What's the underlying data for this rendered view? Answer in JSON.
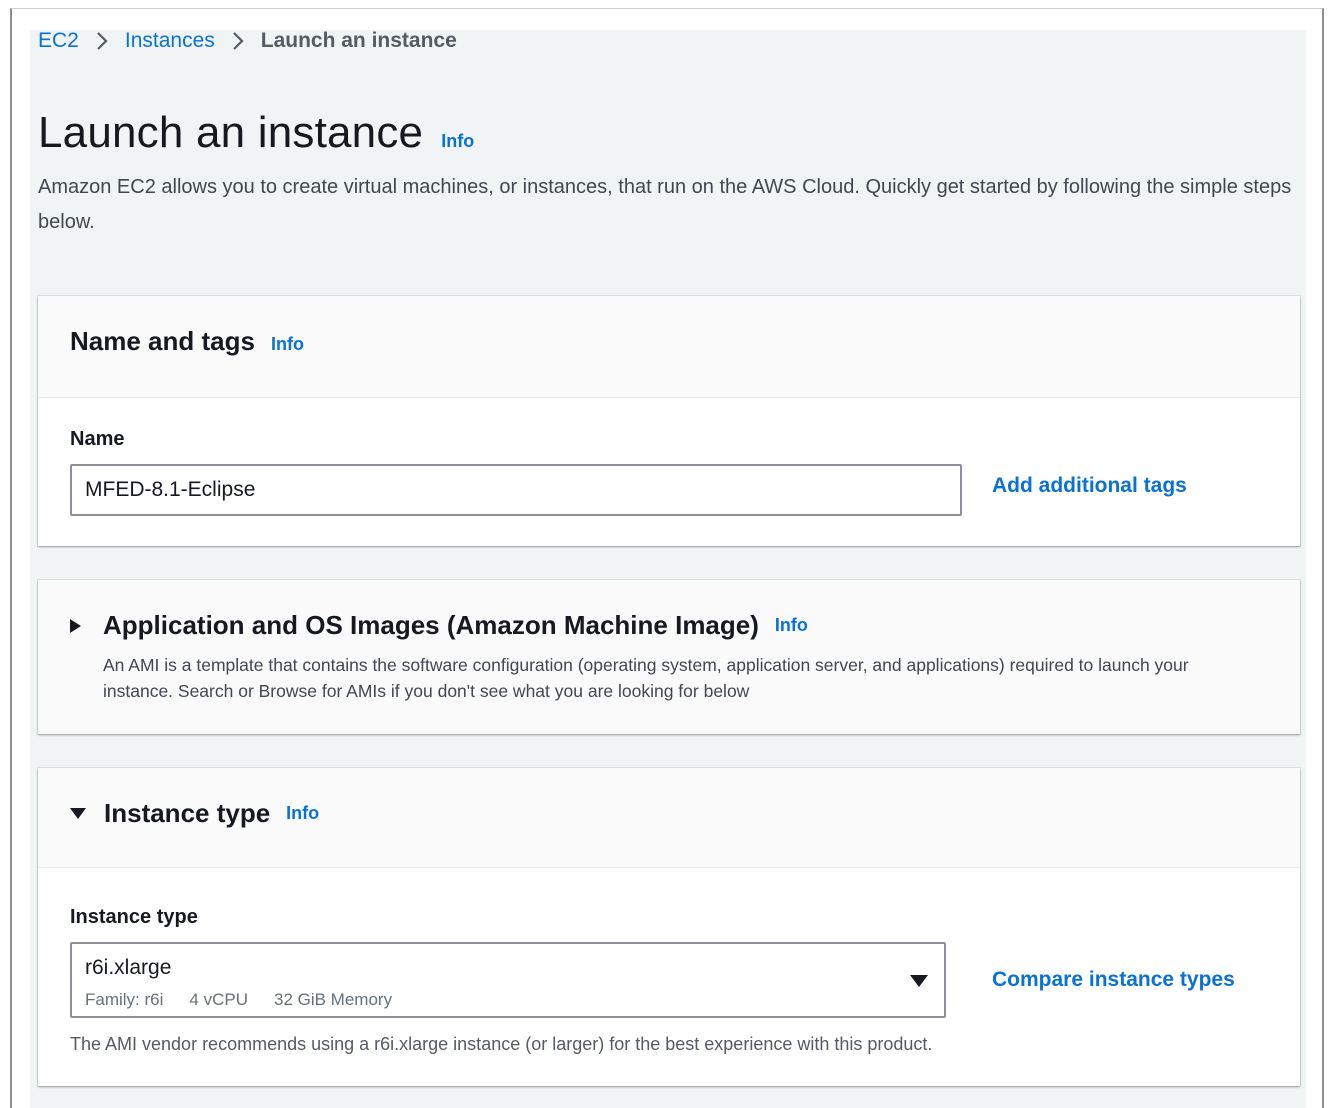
{
  "breadcrumb": {
    "items": [
      "EC2",
      "Instances"
    ],
    "current": "Launch an instance"
  },
  "page": {
    "title": "Launch an instance",
    "info": "Info",
    "description": "Amazon EC2 allows you to create virtual machines, or instances, that run on the AWS Cloud. Quickly get started by following the simple steps below."
  },
  "name_and_tags": {
    "title": "Name and tags",
    "info": "Info",
    "name_label": "Name",
    "name_value": "MFED-8.1-Eclipse",
    "add_tags_link": "Add additional tags"
  },
  "ami": {
    "title": "Application and OS Images (Amazon Machine Image)",
    "info": "Info",
    "description": "An AMI is a template that contains the software configuration (operating system, application server, and applications) required to launch your instance. Search or Browse for AMIs if you don't see what you are looking for below",
    "expanded": false
  },
  "instance_type": {
    "title": "Instance type",
    "info": "Info",
    "expanded": true,
    "field_label": "Instance type",
    "selected": "r6i.xlarge",
    "family": "Family: r6i",
    "vcpu": "4 vCPU",
    "memory": "32 GiB Memory",
    "compare_link": "Compare instance types",
    "hint": "The AMI vendor recommends using a r6i.xlarge instance (or larger) for the best experience with this product."
  },
  "colors": {
    "link": "#0972d3",
    "page_background": "#f1f4f4",
    "panel_header": "#fafafa",
    "text": "#16191f"
  }
}
